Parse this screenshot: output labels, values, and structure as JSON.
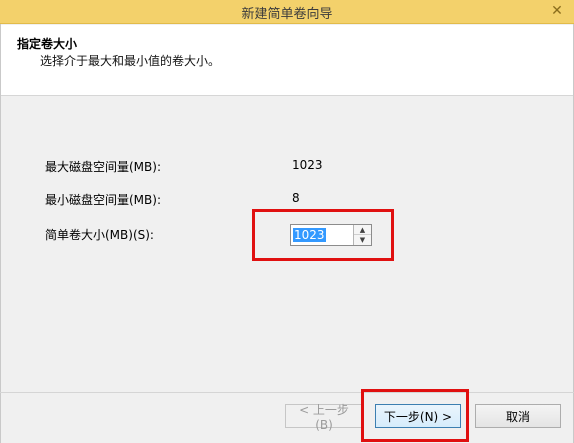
{
  "window": {
    "title": "新建简单卷向导"
  },
  "header": {
    "title": "指定卷大小",
    "subtitle": "选择介于最大和最小值的卷大小。"
  },
  "form": {
    "max_label": "最大磁盘空间量(MB):",
    "max_value": "1023",
    "min_label": "最小磁盘空间量(MB):",
    "min_value": "8",
    "size_label": "简单卷大小(MB)(S):",
    "size_value": "1023"
  },
  "buttons": {
    "back": "< 上一步(B)",
    "next": "下一步(N) >",
    "cancel": "取消"
  },
  "icons": {
    "close": "close-icon",
    "spin_up": "chevron-up-icon",
    "spin_down": "chevron-down-icon"
  },
  "colors": {
    "titlebar": "#f3d16b",
    "highlight": "#e01010",
    "selection": "#3399ff"
  }
}
